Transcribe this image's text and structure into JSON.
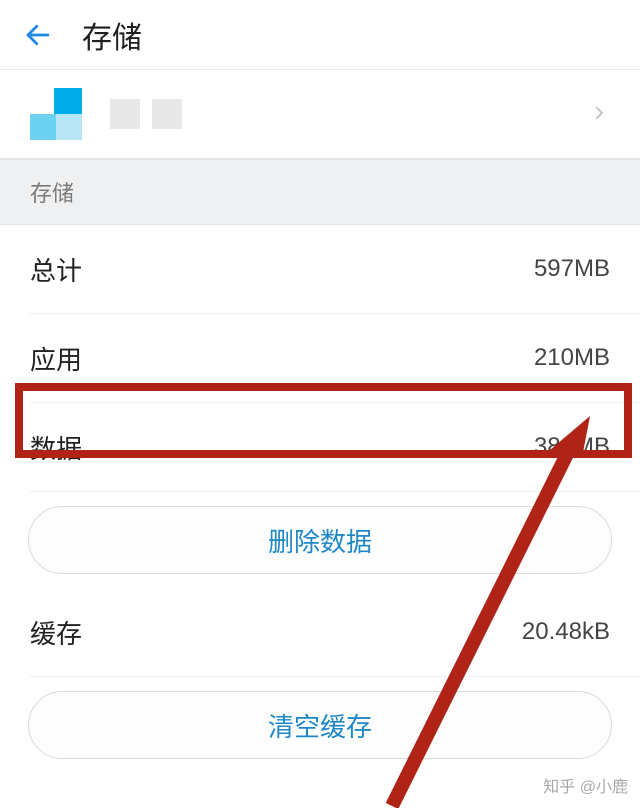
{
  "header": {
    "title": "存储"
  },
  "section": {
    "label": "存储"
  },
  "rows": {
    "total": {
      "label": "总计",
      "value": "597MB"
    },
    "app": {
      "label": "应用",
      "value": "210MB"
    },
    "data": {
      "label": "数据",
      "value": "388MB"
    },
    "cache": {
      "label": "缓存",
      "value": "20.48kB"
    }
  },
  "buttons": {
    "delete_data": "删除数据",
    "clear_cache": "清空缓存"
  },
  "watermark": "知乎 @小鹿"
}
